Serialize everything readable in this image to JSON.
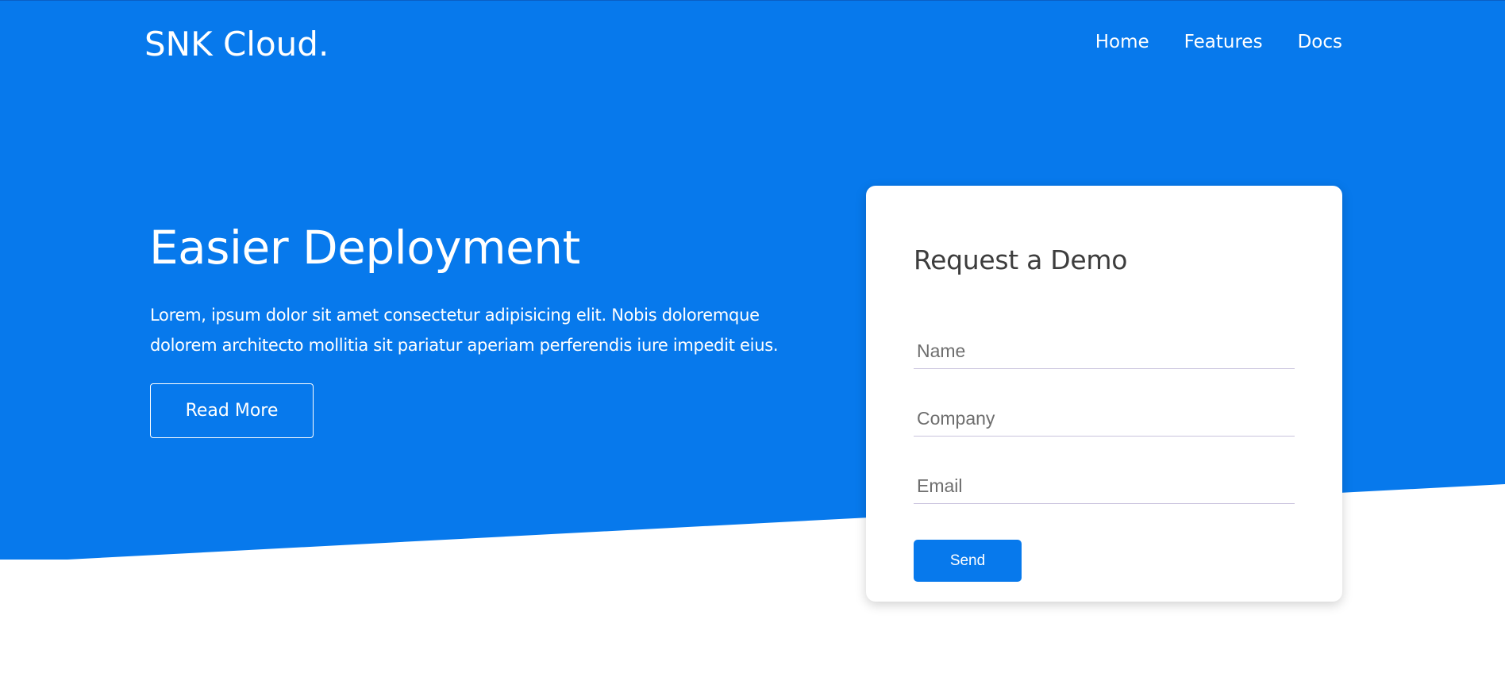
{
  "colors": {
    "brand_blue": "#0779ec",
    "background": "#ffffff",
    "card_title": "#3d3d3d",
    "input_underline": "#c9c3dd"
  },
  "header": {
    "logo": "SNK Cloud.",
    "nav": [
      {
        "label": "Home"
      },
      {
        "label": "Features"
      },
      {
        "label": "Docs"
      }
    ]
  },
  "hero": {
    "title": "Easier Deployment",
    "text": "Lorem, ipsum dolor sit amet consectetur adipisicing elit. Nobis doloremque dolorem architecto mollitia sit pariatur aperiam perferendis iure impedit eius.",
    "read_more_label": "Read More"
  },
  "demo_form": {
    "title": "Request a Demo",
    "name_placeholder": "Name",
    "company_placeholder": "Company",
    "email_placeholder": "Email",
    "send_label": "Send"
  }
}
